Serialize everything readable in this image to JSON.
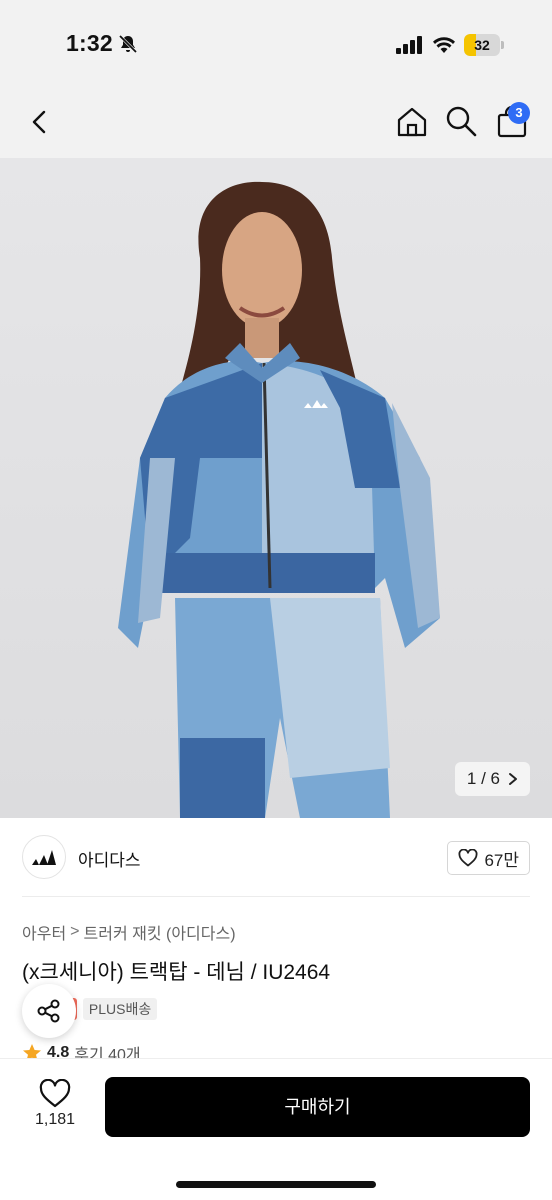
{
  "status_bar": {
    "time": "1:32",
    "battery_level": "32",
    "battery_fraction": 0.32,
    "icons": [
      "bell-slash-icon",
      "cellular-signal-icon",
      "wifi-icon",
      "battery-icon"
    ]
  },
  "nav": {
    "icons": [
      "chevron-left-icon",
      "home-icon",
      "search-icon",
      "shopping-bag-icon"
    ],
    "cart_count": "3"
  },
  "gallery": {
    "current": "1",
    "separator": "/",
    "total": "6",
    "next_icon": "chevron-right-icon"
  },
  "brand": {
    "name": "아디다스",
    "logo": "adidas-logo",
    "likes": "67만"
  },
  "breadcrumb": {
    "items": [
      "아우터",
      "트러커 재킷 (아디다스)"
    ],
    "separator": ">"
  },
  "product": {
    "title": "(x크세니아) 트랙탑 - 데님 / IU2464",
    "badges": {
      "sale": "일",
      "delivery": "PLUS배송"
    },
    "rating": "4.8",
    "reviews": "후기 40개"
  },
  "bottom_bar": {
    "wish_count": "1,181",
    "buy_label": "구매하기"
  },
  "colors": {
    "accent_badge": "#2f6cf5",
    "buy_button": "#000000",
    "sale_badge": "#f06b5a",
    "star": "#f5a623"
  }
}
